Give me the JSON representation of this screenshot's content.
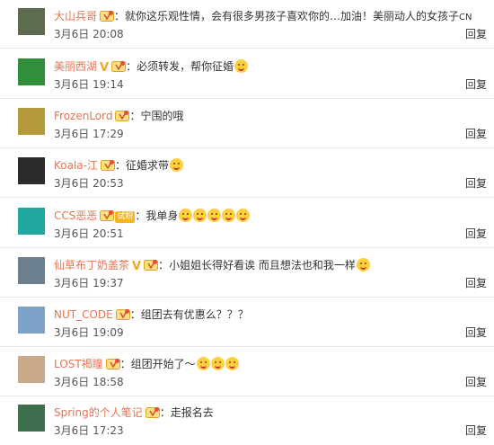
{
  "comments": [
    {
      "username": "大山兵哥",
      "verified": false,
      "tag": "",
      "content": "：就你这乐观性情，会有很多男孩子喜欢你的…加油！美丽动人的女孩子",
      "suffix": "CN",
      "emoji_count": 0,
      "time": "3月6日 20:08",
      "reply": "回复",
      "avatar_color": "#5d6b4f"
    },
    {
      "username": "美丽西湖",
      "verified": true,
      "tag": "",
      "content": "：必须转发，帮你征婚",
      "suffix": "",
      "emoji_count": 1,
      "time": "3月6日 19:14",
      "reply": "回复",
      "avatar_color": "#2f8f3a"
    },
    {
      "username": "FrozenLord",
      "verified": false,
      "tag": "",
      "content": "：宁围的哦",
      "suffix": "",
      "emoji_count": 0,
      "time": "3月6日 17:29",
      "reply": "回复",
      "avatar_color": "#b59a3c"
    },
    {
      "username": "Koala-江",
      "verified": false,
      "tag": "",
      "content": "：征婚求带",
      "suffix": "",
      "emoji_count": 1,
      "time": "3月6日 20:53",
      "reply": "回复",
      "avatar_color": "#2b2b2b"
    },
    {
      "username": "CCS恶恶",
      "verified": false,
      "tag": "试粉",
      "content": "：我单身",
      "suffix": "",
      "emoji_count": 5,
      "time": "3月6日 20:51",
      "reply": "回复",
      "avatar_color": "#1fa7a0"
    },
    {
      "username": "仙草布丁奶盖茶",
      "verified": true,
      "tag": "",
      "content": "：小姐姐长得好看诶 而且想法也和我一样",
      "suffix": "",
      "emoji_count": 1,
      "time": "3月6日 19:37",
      "reply": "回复",
      "avatar_color": "#6b7f8f"
    },
    {
      "username": "NUT_CODE",
      "verified": false,
      "tag": "",
      "content": "：组团去有优惠么？？？",
      "suffix": "",
      "emoji_count": 0,
      "time": "3月6日 19:09",
      "reply": "回复",
      "avatar_color": "#7fa2c9"
    },
    {
      "username": "LOST褐瞳",
      "verified": false,
      "tag": "",
      "content": "：组团开始了～",
      "suffix": "",
      "emoji_count": 3,
      "time": "3月6日 18:58",
      "reply": "回复",
      "avatar_color": "#caa88a"
    },
    {
      "username": "Spring的个人笔记",
      "verified": false,
      "tag": "",
      "content": "：走报名去",
      "suffix": "",
      "emoji_count": 0,
      "time": "3月6日 17:23",
      "reply": "回复",
      "avatar_color": "#3e6f4f"
    }
  ]
}
